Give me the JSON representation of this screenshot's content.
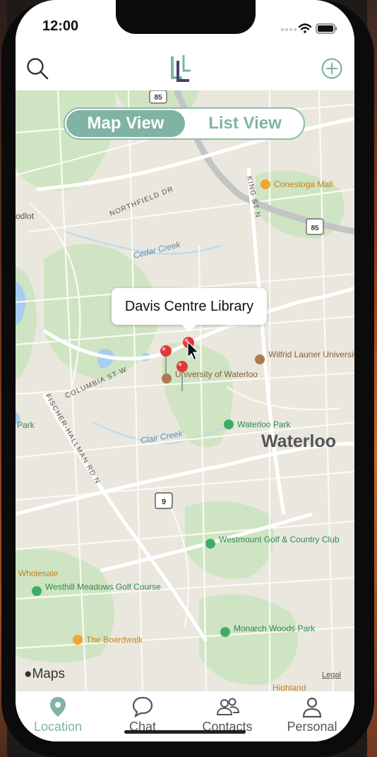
{
  "status_bar": {
    "time": "12:00"
  },
  "nav": {
    "search_icon": "search-icon",
    "logo_icon": "app-logo-icon",
    "add_icon": "add-circle-icon"
  },
  "segmented": {
    "options": [
      "Map View",
      "List View"
    ],
    "selected": "Map View"
  },
  "map": {
    "callout": "Davis Centre Library",
    "roads": [
      "NORTHFIELD DR",
      "KING ST N",
      "COLUMBIA ST W",
      "FISCHER-HALLMAN RD N",
      "Cedar Creek",
      "Clair Creek"
    ],
    "shields": [
      "85",
      "85",
      "9"
    ],
    "places": [
      "Conestoga Mall",
      "Wilfrid Laurier University",
      "University of Waterloo",
      "Waterloo Park",
      "Waterloo",
      "Westmount Golf & Country Club",
      "Westhill Meadows Golf Course",
      "The Boardwalk",
      "Monarch Woods Park",
      "Highland",
      "Wholesale",
      "odlot",
      "Park"
    ],
    "attribution": "Maps",
    "legal": "Legal"
  },
  "tabs": [
    {
      "label": "Location",
      "icon": "location-pin-icon"
    },
    {
      "label": "Chat",
      "icon": "chat-bubble-icon"
    },
    {
      "label": "Contacts",
      "icon": "contacts-icon"
    },
    {
      "label": "Personal",
      "icon": "person-icon"
    }
  ],
  "colors": {
    "accent": "#7fb4a2",
    "pin": "#e0393b"
  }
}
